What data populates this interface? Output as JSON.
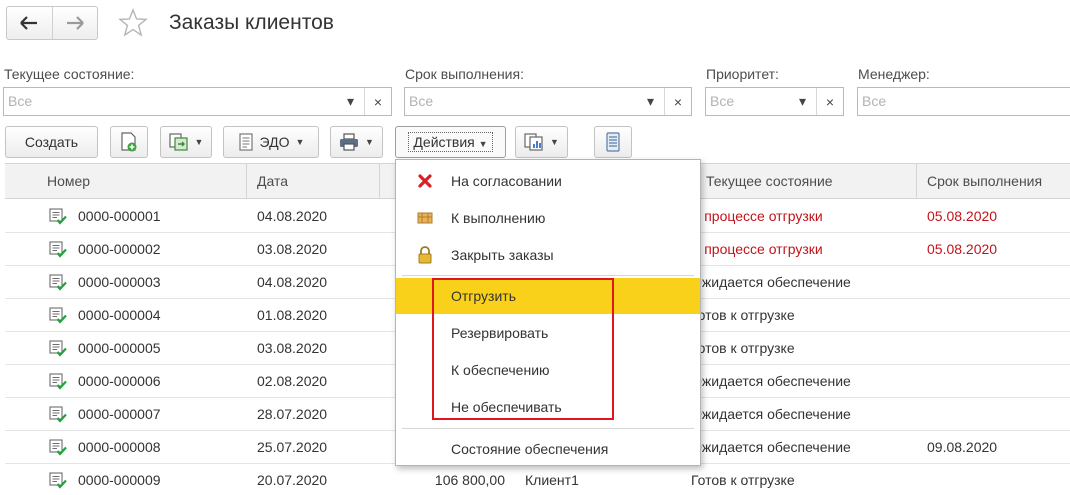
{
  "header": {
    "title": "Заказы клиентов",
    "back_icon": "arrow-left-icon",
    "forward_icon": "arrow-right-icon",
    "favorite_icon": "star-icon"
  },
  "filters": [
    {
      "label": "Текущее состояние:",
      "placeholder": "Все"
    },
    {
      "label": "Срок выполнения:",
      "placeholder": "Все"
    },
    {
      "label": "Приоритет:",
      "placeholder": "Все"
    },
    {
      "label": "Менеджер:",
      "placeholder": "Все"
    }
  ],
  "toolbar": {
    "create_label": "Создать",
    "edo_label": "ЭДО",
    "actions_label": "Действия"
  },
  "table": {
    "columns": [
      "Номер",
      "Дата",
      "Текущее состояние",
      "Срок выполнения"
    ],
    "rows": [
      {
        "number": "0000-000001",
        "date": "04.08.2020",
        "state": "В процессе отгрузки",
        "due": "05.08.2020",
        "amount": "",
        "client": ""
      },
      {
        "number": "0000-000002",
        "date": "03.08.2020",
        "state": "В процессе отгрузки",
        "due": "05.08.2020",
        "amount": "",
        "client": ""
      },
      {
        "number": "0000-000003",
        "date": "04.08.2020",
        "state": "Ожидается обеспечение",
        "due": "",
        "amount": "",
        "client": ""
      },
      {
        "number": "0000-000004",
        "date": "01.08.2020",
        "state": "Готов к отгрузке",
        "due": "",
        "amount": "",
        "client": ""
      },
      {
        "number": "0000-000005",
        "date": "03.08.2020",
        "state": "Готов к отгрузке",
        "due": "",
        "amount": "",
        "client": ""
      },
      {
        "number": "0000-000006",
        "date": "02.08.2020",
        "state": "Ожидается обеспечение",
        "due": "",
        "amount": "",
        "client": ""
      },
      {
        "number": "0000-000007",
        "date": "28.07.2020",
        "state": "Ожидается обеспечение",
        "due": "",
        "amount": "",
        "client": ""
      },
      {
        "number": "0000-000008",
        "date": "25.07.2020",
        "state": "Ожидается обеспечение",
        "due": "09.08.2020",
        "amount": "",
        "client": ""
      },
      {
        "number": "0000-000009",
        "date": "20.07.2020",
        "state": "Готов к отгрузке",
        "due": "",
        "amount": "106 800,00",
        "client": "Клиент1"
      }
    ]
  },
  "menu": {
    "items": [
      {
        "label": "На согласовании",
        "icon": "red-cross-icon"
      },
      {
        "label": "К выполнению",
        "icon": "box-icon"
      },
      {
        "label": "Закрыть заказы",
        "icon": "lock-icon"
      },
      {
        "label": "Отгрузить",
        "icon": ""
      },
      {
        "label": "Резервировать",
        "icon": ""
      },
      {
        "label": "К обеспечению",
        "icon": ""
      },
      {
        "label": "Не обеспечивать",
        "icon": ""
      },
      {
        "label": "Состояние обеспечения",
        "icon": ""
      }
    ],
    "highlighted": "Отгрузить"
  },
  "colors": {
    "highlight": "#fad11a",
    "status_red": "#c3131a",
    "annotation_box": "#e0161f"
  }
}
